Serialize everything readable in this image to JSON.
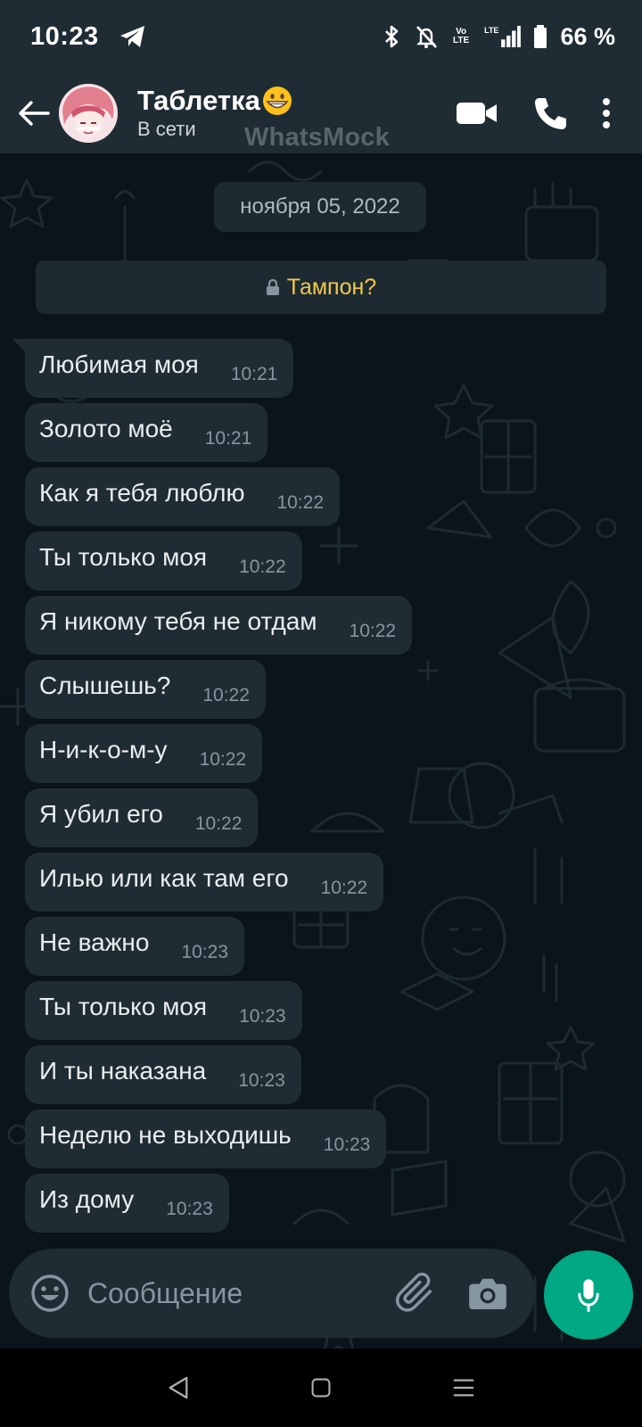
{
  "status_bar": {
    "time": "10:23",
    "volte": "Vo\nLTE",
    "lte": "LTE",
    "battery": "66 %"
  },
  "header": {
    "contact_name": "Таблетка",
    "contact_status": "В сети",
    "watermark": "WhatsMock"
  },
  "chat": {
    "date": "ноября 05, 2022",
    "notice": "Тампон?",
    "messages": [
      {
        "text": "Любимая моя",
        "time": "10:21"
      },
      {
        "text": "Золото моё",
        "time": "10:21"
      },
      {
        "text": "Как я тебя люблю",
        "time": "10:22"
      },
      {
        "text": "Ты только моя",
        "time": "10:22"
      },
      {
        "text": "Я никому тебя не отдам",
        "time": "10:22"
      },
      {
        "text": "Слышешь?",
        "time": "10:22"
      },
      {
        "text": "Н-и-к-о-м-у",
        "time": "10:22"
      },
      {
        "text": "Я убил его",
        "time": "10:22"
      },
      {
        "text": "Илью или как там его",
        "time": "10:22"
      },
      {
        "text": "Не важно",
        "time": "10:23"
      },
      {
        "text": "Ты только моя",
        "time": "10:23"
      },
      {
        "text": "И ты наказана",
        "time": "10:23"
      },
      {
        "text": "Неделю не выходишь",
        "time": "10:23"
      },
      {
        "text": "Из дому",
        "time": "10:23"
      }
    ]
  },
  "composer": {
    "placeholder": "Сообщение"
  },
  "colors": {
    "header_bg": "#1f2c34",
    "chat_bg": "#0b141a",
    "bubble_in": "#202c33",
    "accent": "#00a884",
    "notice_text": "#f2c94c"
  },
  "icons": {
    "status": [
      "telegram-icon",
      "bluetooth-icon",
      "mute-icon",
      "volte-icon",
      "signal-icon",
      "battery-icon"
    ],
    "header": [
      "back-arrow-icon",
      "video-call-icon",
      "phone-icon",
      "more-vert-icon"
    ],
    "composer": [
      "emoji-icon",
      "attach-icon",
      "camera-icon",
      "mic-icon"
    ],
    "nav": [
      "nav-back-icon",
      "nav-home-icon",
      "nav-recents-icon"
    ]
  }
}
